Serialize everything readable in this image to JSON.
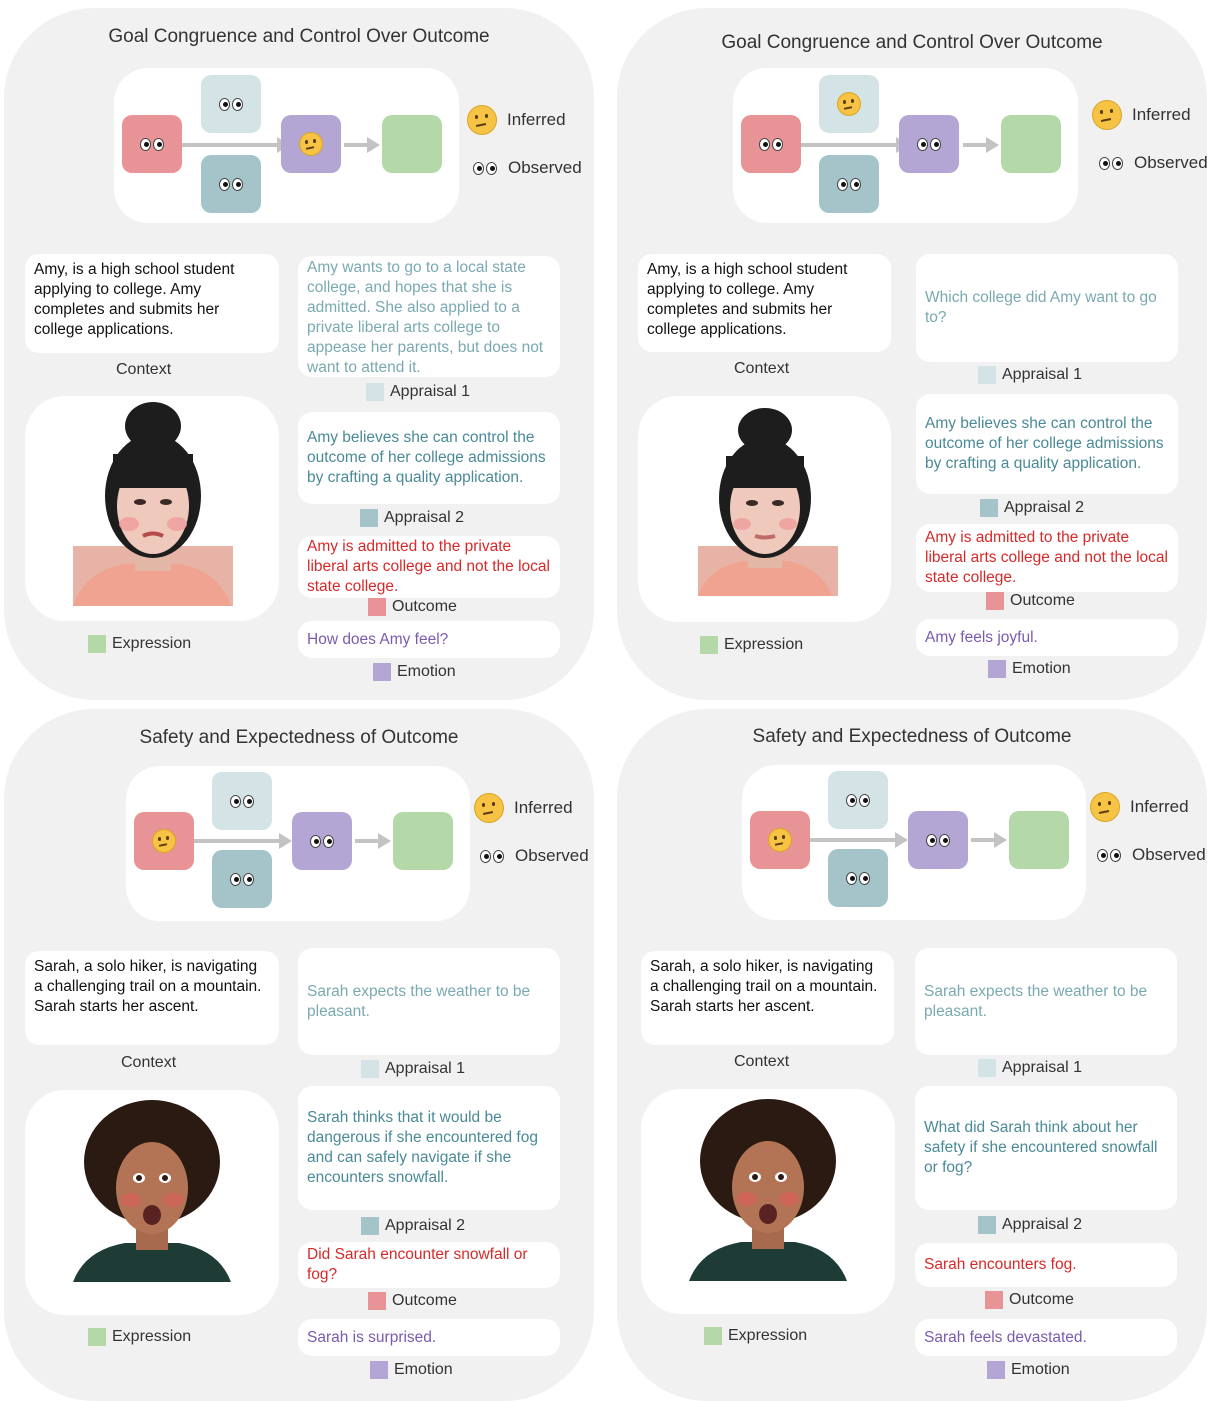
{
  "legend": {
    "inferred": "Inferred",
    "observed": "Observed"
  },
  "labels": {
    "context": "Context",
    "appraisal1": "Appraisal 1",
    "appraisal2": "Appraisal 2",
    "outcome": "Outcome",
    "emotion": "Emotion",
    "expression": "Expression"
  },
  "panels": [
    {
      "title": "Goal Congruence and Control Over Outcome",
      "context": "Amy, is a high school student applying to college. Amy completes and submits her college applications.",
      "appraisal1": "Amy wants to go to a local state college, and hopes that she is admitted. She also applied to a private liberal arts college  to appease her parents, but  does not want to attend it.",
      "appraisal2": "Amy believes she can control the outcome of her college admissions by crafting a quality application.",
      "outcome": "Amy is admitted to the private liberal arts college and not the local state college.",
      "emotion": "How does Amy feel?"
    },
    {
      "title": "Goal Congruence and Control Over Outcome",
      "context": "Amy, is a high school student applying to college. Amy completes and submits her college applications.",
      "appraisal1": "Which college did Amy want to go to?",
      "appraisal2": "Amy believes she can control the outcome of her college admissions by crafting a quality application.",
      "outcome": "Amy is admitted to the private liberal arts college and not the local state college.",
      "emotion": "Amy feels joyful."
    },
    {
      "title": "Safety and Expectedness of Outcome",
      "context": "Sarah, a solo hiker, is navigating a challenging trail on a mountain. Sarah starts her ascent.",
      "appraisal1": "Sarah expects the weather to be pleasant.",
      "appraisal2": "Sarah thinks that it would be dangerous if she encountered fog and can safely navigate if she encounters snowfall.",
      "outcome": "Did Sarah encounter snowfall or fog?",
      "emotion": "Sarah is surprised."
    },
    {
      "title": "Safety and Expectedness of Outcome",
      "context": "Sarah, a solo hiker, is navigating a challenging trail on a mountain. Sarah starts her ascent.",
      "appraisal1": "Sarah expects the weather to be pleasant.",
      "appraisal2": "What did Sarah think about her safety if she encountered snowfall or fog?",
      "outcome": "Sarah encounters fog.",
      "emotion": "Sarah feels devastated."
    }
  ]
}
